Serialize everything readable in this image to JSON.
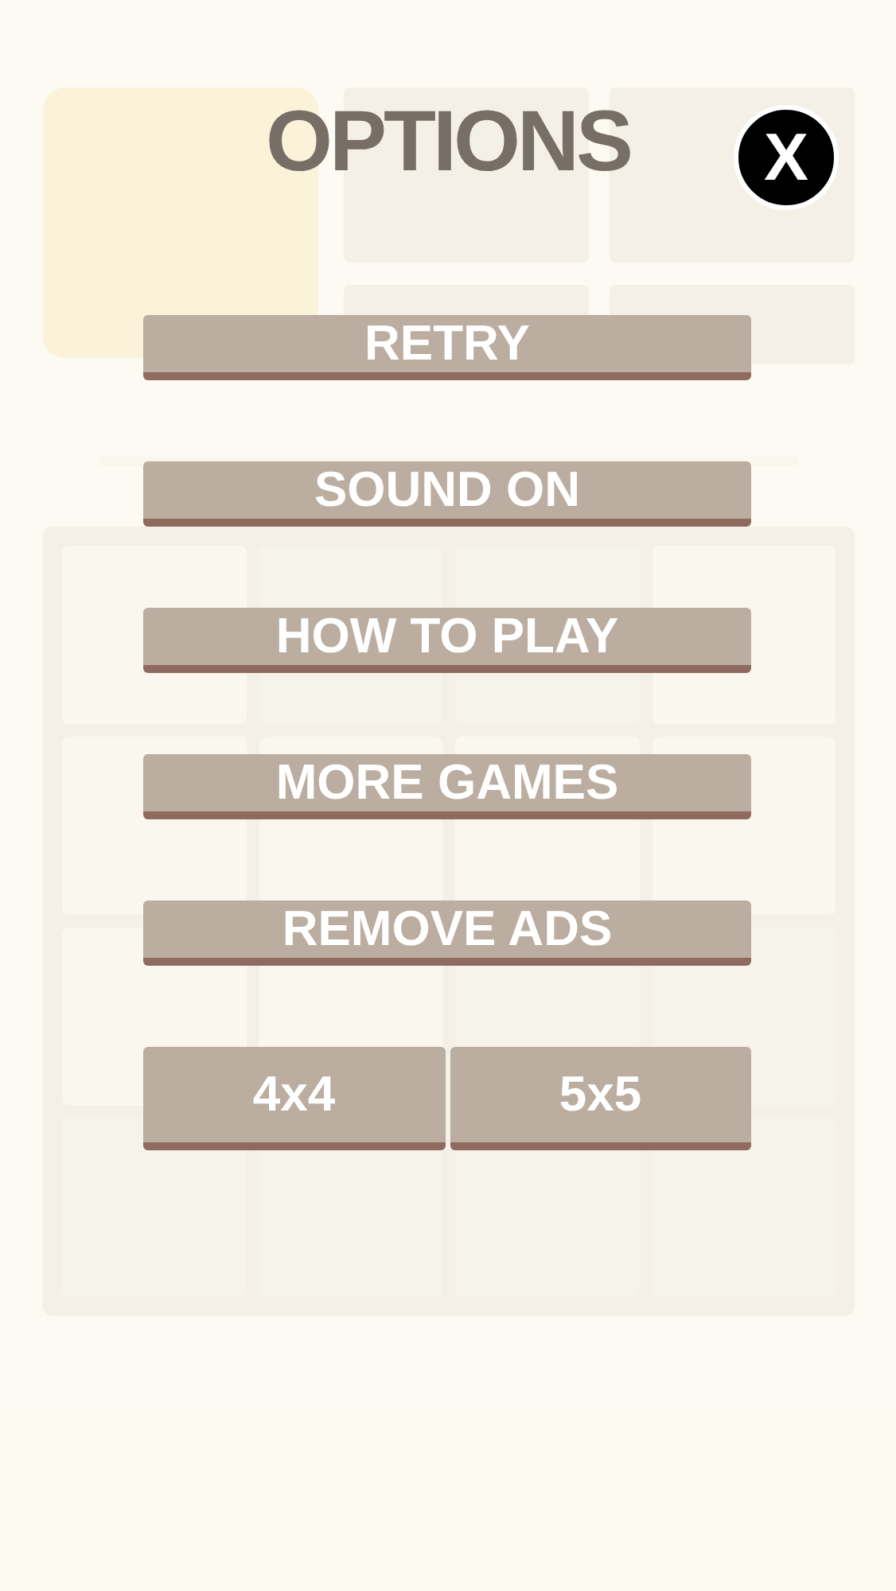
{
  "options": {
    "title": "OPTIONS",
    "close": "X",
    "buttons": [
      {
        "label": "RETRY"
      },
      {
        "label": "SOUND ON"
      },
      {
        "label": "HOW TO PLAY"
      },
      {
        "label": "MORE GAMES"
      },
      {
        "label": "REMOVE ADS"
      }
    ],
    "grid_sizes": [
      {
        "label": "4x4"
      },
      {
        "label": "5x5"
      }
    ]
  }
}
